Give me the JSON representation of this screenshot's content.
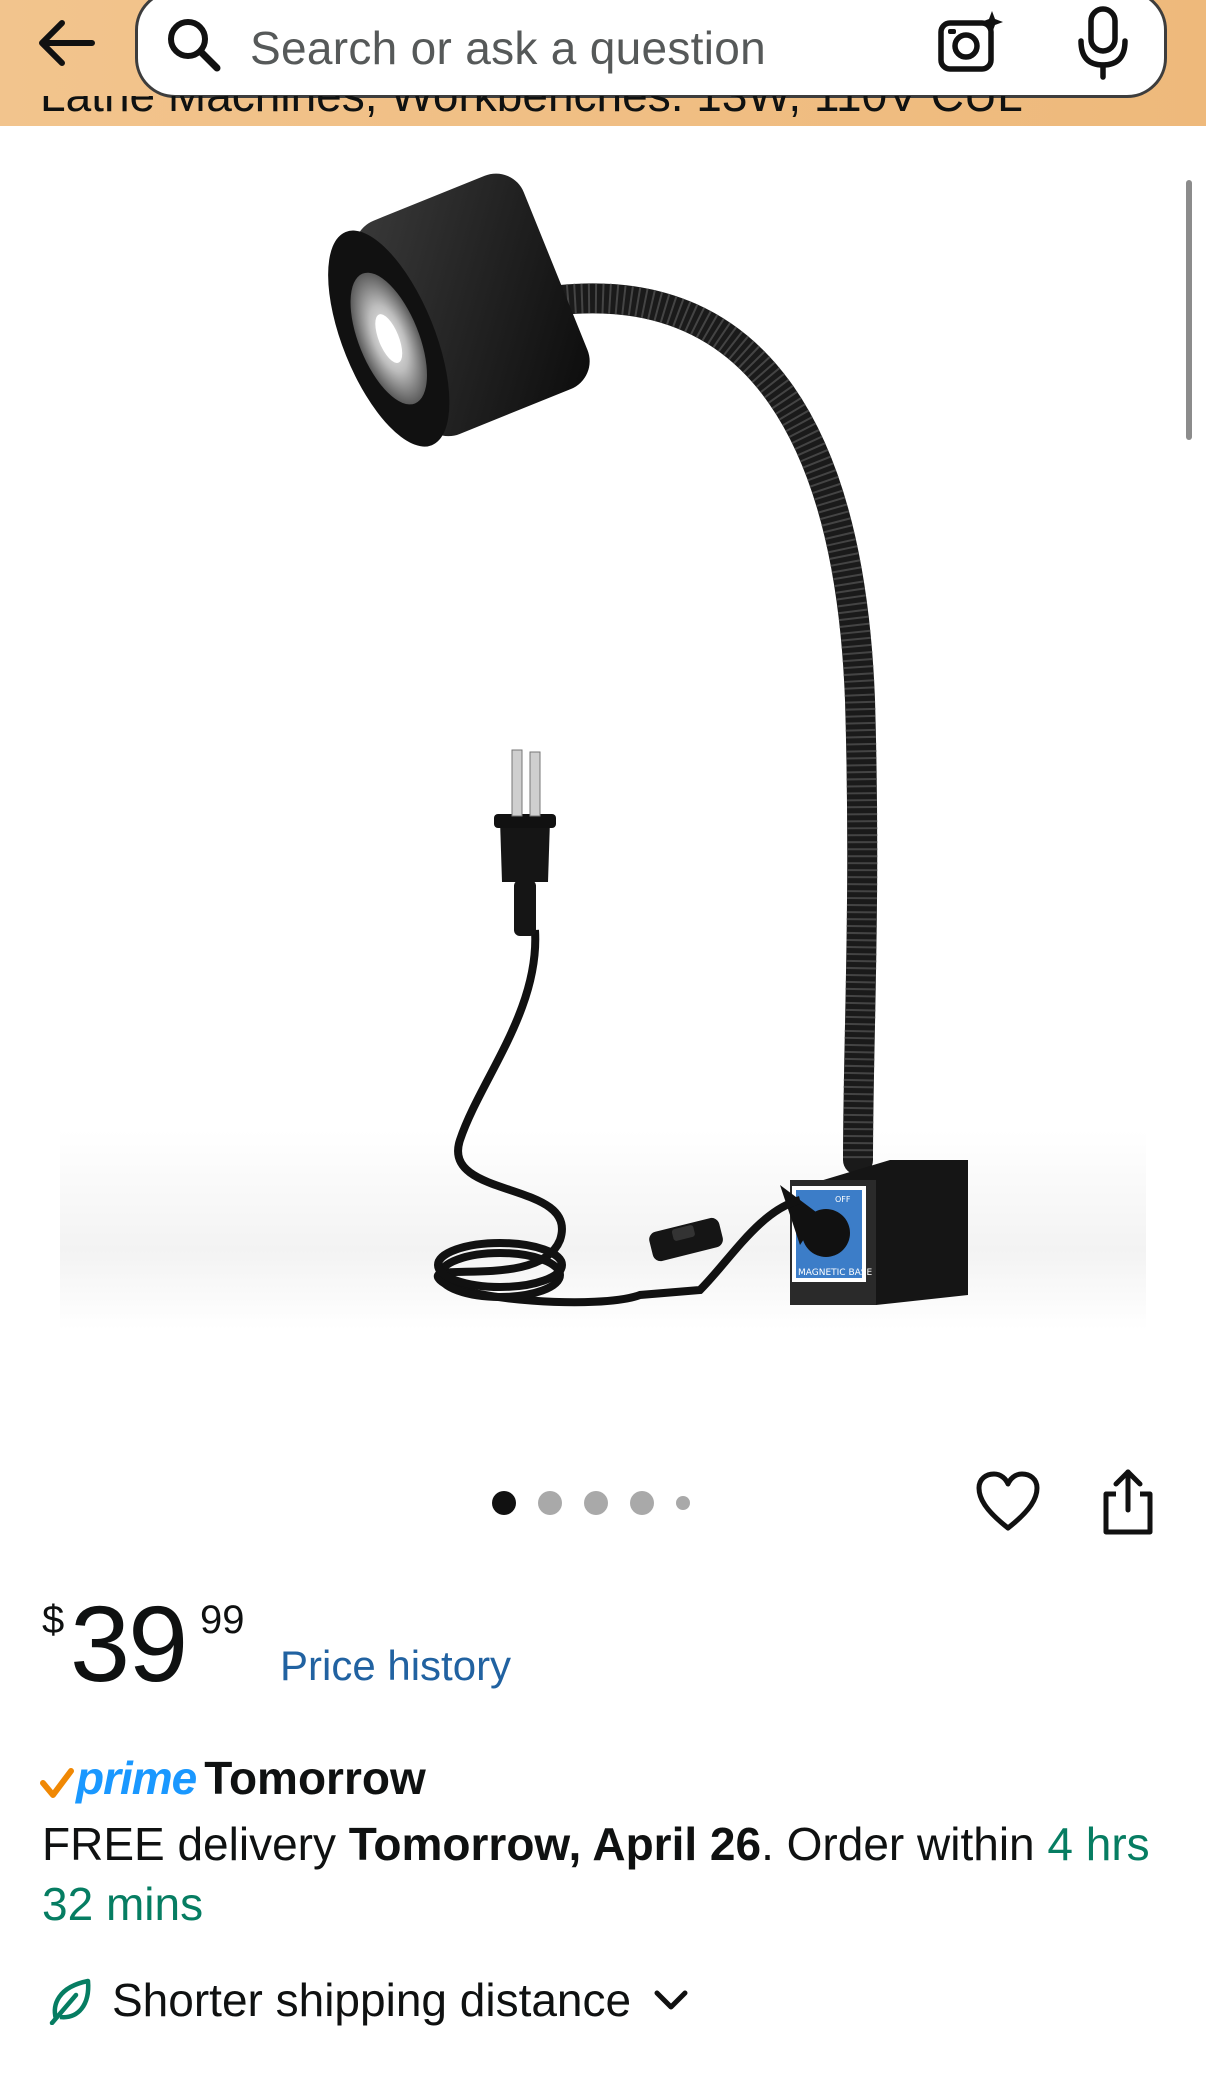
{
  "header": {
    "search_placeholder": "Search or ask a question",
    "back_icon": "back-arrow-icon",
    "camera_icon": "camera-icon",
    "mic_icon": "microphone-icon",
    "background_color": "#f0bd82"
  },
  "title_fragment": "Lathe Machines, Workbenches. 13W, 110V CUL",
  "gallery": {
    "image_count": 5,
    "active_index": 0,
    "base_label": "MAGNETIC BASE",
    "knob_label": "OFF"
  },
  "price": {
    "symbol": "$",
    "whole": "39",
    "fraction": "99",
    "history_link": "Price history"
  },
  "prime": {
    "word": "prime",
    "speed": "Tomorrow",
    "accent_color": "#1a98ff"
  },
  "delivery": {
    "prefix": "FREE delivery ",
    "date": "Tomorrow, April 26",
    "order_within": ". Order within ",
    "countdown": "4 hrs 32 mins"
  },
  "shipping": {
    "label": "Shorter shipping distance",
    "icon": "leaf-icon"
  }
}
